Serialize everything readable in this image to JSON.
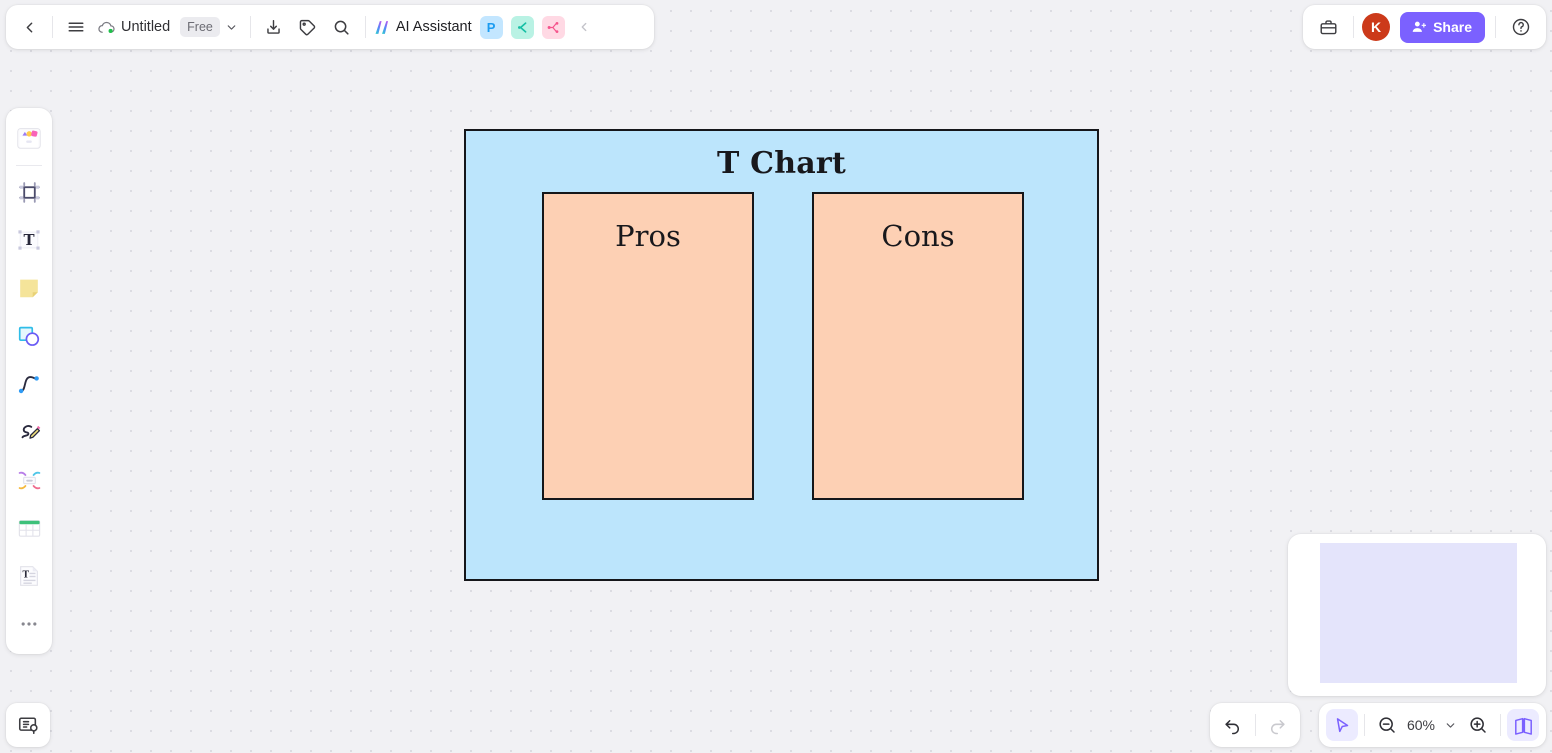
{
  "app": {
    "accent_color": "#7b61ff",
    "canvas_bg": "#f1f1f4"
  },
  "header": {
    "back_label": "back-arrow",
    "menu_label": "main-menu",
    "cloud_status": "saved",
    "doc_title": "Untitled",
    "plan_badge": "Free",
    "title_dropdown": "⌄",
    "import_label": "import",
    "tag_label": "tag",
    "search_label": "search",
    "ai_assistant_label": "AI Assistant",
    "apps": [
      {
        "name": "presentation-app",
        "glyph": "P"
      },
      {
        "name": "concept-map-app",
        "glyph": ""
      },
      {
        "name": "mind-map-app",
        "glyph": ""
      }
    ],
    "collapse_label": "‹",
    "briefcase_label": "workspace",
    "avatar_initial": "K",
    "avatar_color": "#cc3a1a",
    "share_label": "Share",
    "help_label": "?"
  },
  "toolbar": {
    "items": [
      {
        "name": "templates",
        "label": "Templates"
      },
      {
        "name": "frame",
        "label": "Frame"
      },
      {
        "name": "text",
        "label": "Text"
      },
      {
        "name": "sticky-note",
        "label": "Sticky note"
      },
      {
        "name": "shapes",
        "label": "Shapes"
      },
      {
        "name": "connector",
        "label": "Connector line"
      },
      {
        "name": "pen",
        "label": "Pen"
      },
      {
        "name": "mind-map",
        "label": "Mind map"
      },
      {
        "name": "table",
        "label": "Table"
      },
      {
        "name": "document",
        "label": "Document"
      },
      {
        "name": "more-tools",
        "label": "More"
      }
    ]
  },
  "bottom_left": {
    "presentation_label": "Presentation mode"
  },
  "canvas": {
    "tchart": {
      "title": "T Chart",
      "background_color": "#bce5fc",
      "column_color": "#fdd0b4",
      "border_color": "#15161a",
      "columns": [
        {
          "label": "Pros",
          "items": []
        },
        {
          "label": "Cons",
          "items": []
        }
      ]
    }
  },
  "minimap": {
    "label": "Minimap",
    "viewport_color": "#e4e4fb"
  },
  "bottom_bar": {
    "undo_label": "Undo",
    "redo_label": "Redo",
    "redo_disabled": true,
    "select_tool_label": "Select",
    "zoom_out_label": "Zoom out",
    "zoom_level": "60%",
    "zoom_dropdown": "⌄",
    "zoom_in_label": "Zoom in",
    "fit_view_label": "Fit to screen"
  }
}
